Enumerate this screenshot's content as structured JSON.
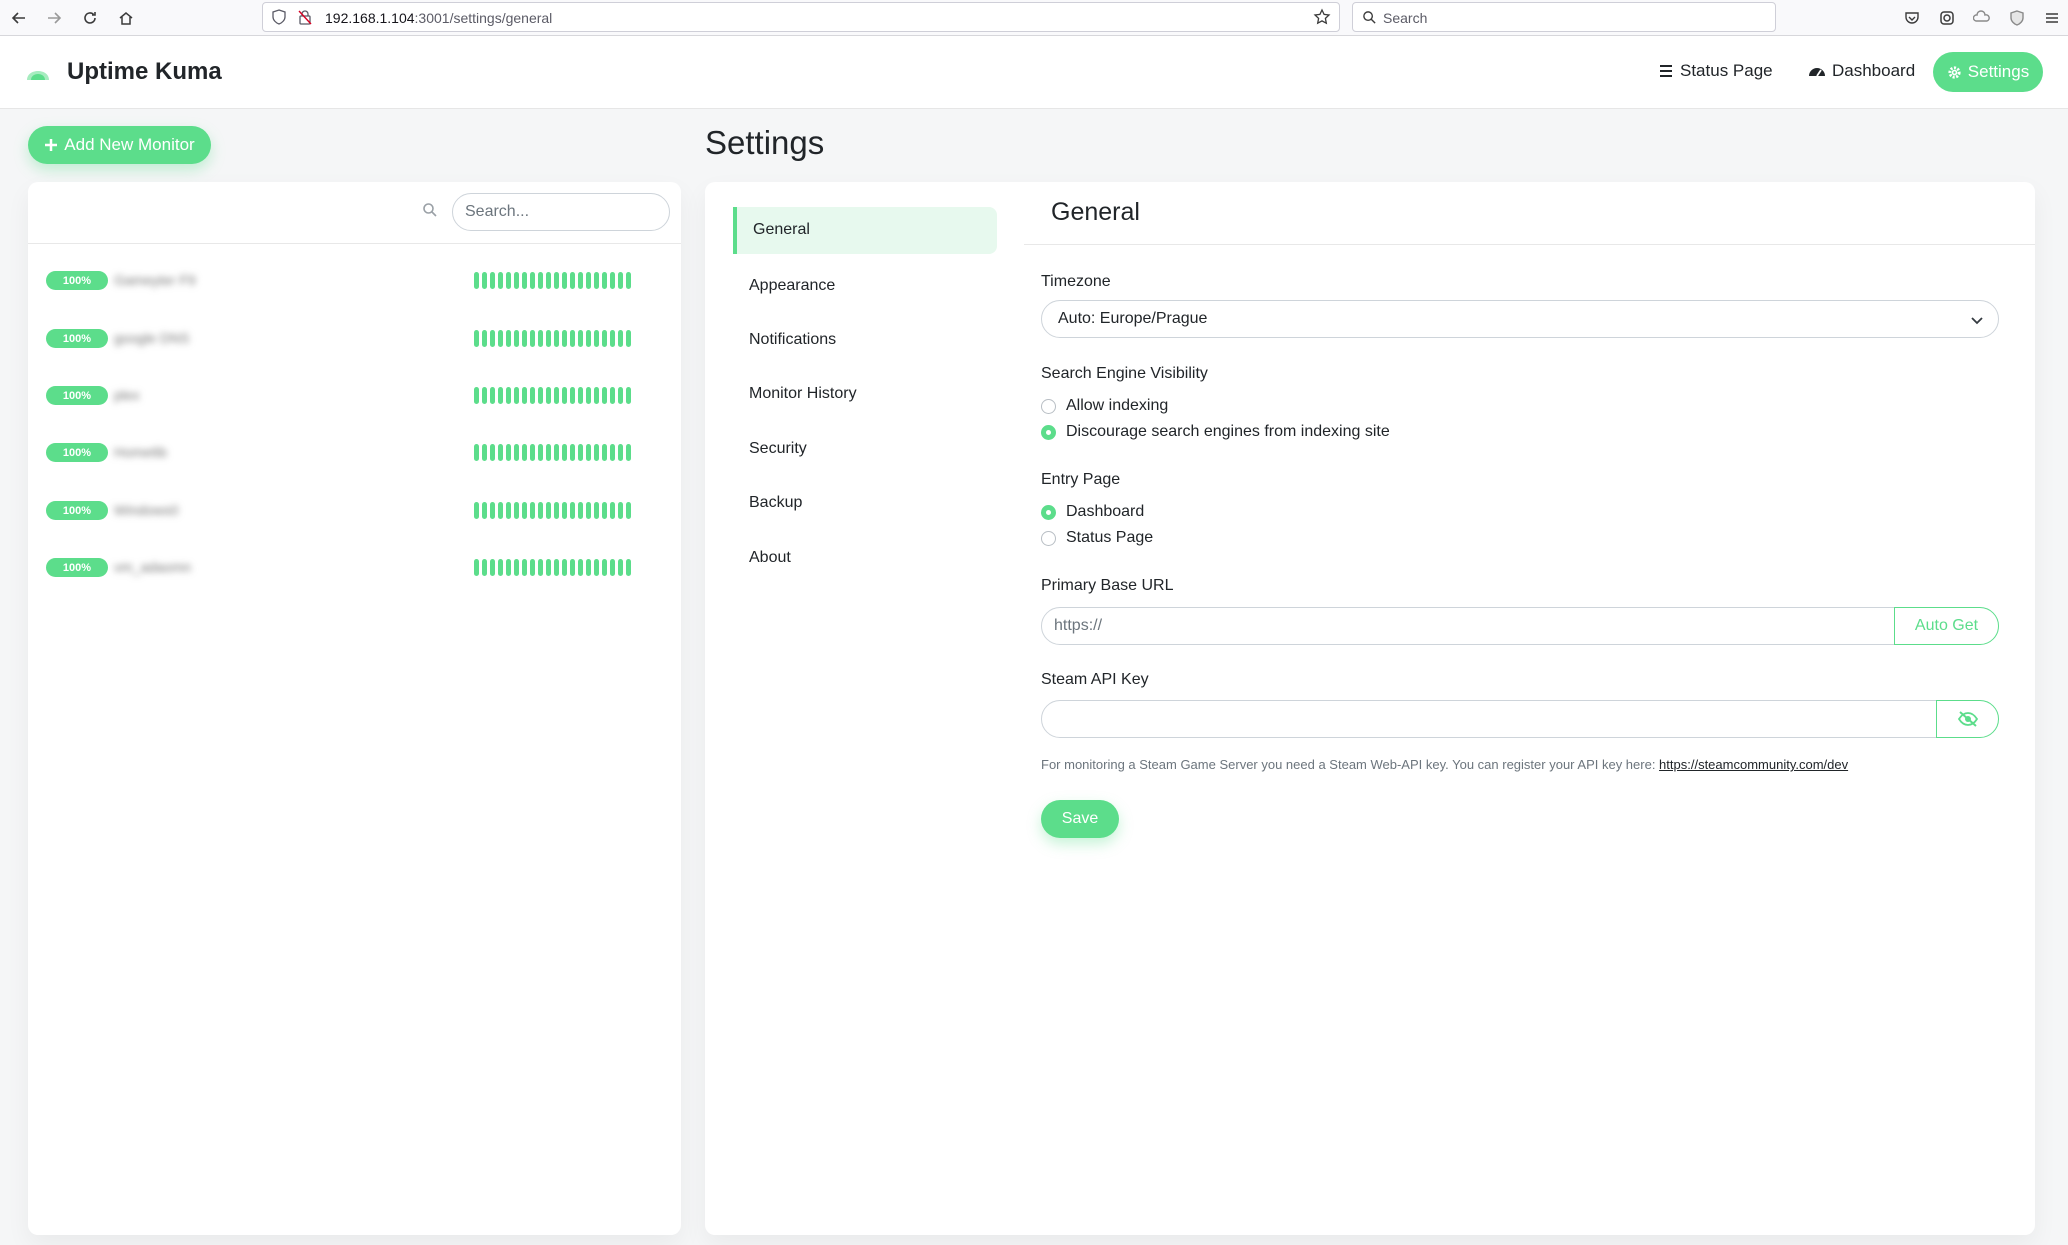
{
  "browser": {
    "url_host": "192.168.1.104",
    "url_path": ":3001/settings/general",
    "search_placeholder": "Search"
  },
  "header": {
    "brand": "Uptime Kuma",
    "status_page": "Status Page",
    "dashboard": "Dashboard",
    "settings": "Settings"
  },
  "sidebar": {
    "add_monitor": "Add New Monitor",
    "search_placeholder": "Search...",
    "monitors": [
      {
        "uptime": "100%",
        "name": "Gameyter F9"
      },
      {
        "uptime": "100%",
        "name": "google DNS"
      },
      {
        "uptime": "100%",
        "name": "plex"
      },
      {
        "uptime": "100%",
        "name": "Home6b"
      },
      {
        "uptime": "100%",
        "name": "Windows0"
      },
      {
        "uptime": "100%",
        "name": "vm_adaomn"
      }
    ]
  },
  "settings": {
    "title": "Settings",
    "menu": [
      "General",
      "Appearance",
      "Notifications",
      "Monitor History",
      "Security",
      "Backup",
      "About"
    ],
    "active_menu": "General",
    "section_title": "General",
    "timezone_label": "Timezone",
    "timezone_value": "Auto: Europe/Prague",
    "visibility_label": "Search Engine Visibility",
    "visibility_allow": "Allow indexing",
    "visibility_discourage": "Discourage search engines from indexing site",
    "entry_label": "Entry Page",
    "entry_dashboard": "Dashboard",
    "entry_status": "Status Page",
    "base_url_label": "Primary Base URL",
    "base_url_placeholder": "https://",
    "auto_get": "Auto Get",
    "steam_label": "Steam API Key",
    "steam_help": "For monitoring a Steam Game Server you need a Steam Web-API key. You can register your API key here: ",
    "steam_link": "https://steamcommunity.com/dev",
    "save": "Save"
  },
  "colors": {
    "accent": "#5cdd8b"
  }
}
